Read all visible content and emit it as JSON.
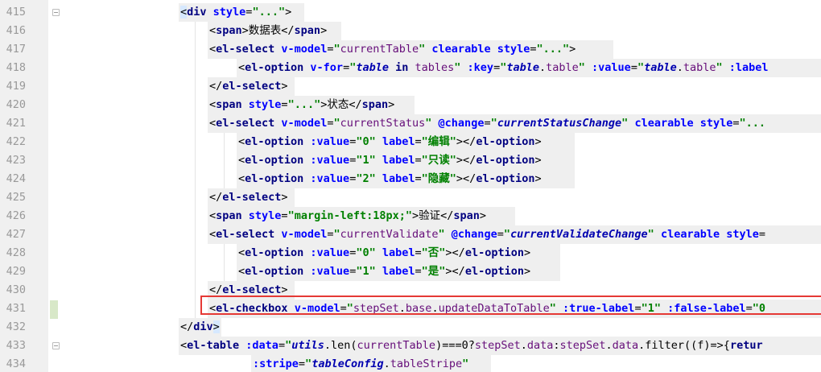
{
  "editor": {
    "lines": [
      {
        "no": "415",
        "segments": [
          {
            "k": "tb",
            "s": "<"
          },
          {
            "k": "t",
            "s": "div "
          },
          {
            "k": "a",
            "s": "style"
          },
          {
            "k": "x",
            "s": "="
          },
          {
            "k": "v",
            "s": "\"...\""
          },
          {
            "k": "x",
            "s": ">"
          }
        ]
      },
      {
        "no": "416",
        "segments": [
          {
            "k": "x",
            "s": "<"
          },
          {
            "k": "t",
            "s": "span"
          },
          {
            "k": "x",
            "s": ">数据表</"
          },
          {
            "k": "t",
            "s": "span"
          },
          {
            "k": "x",
            "s": ">"
          }
        ]
      },
      {
        "no": "417",
        "segments": [
          {
            "k": "x",
            "s": "<"
          },
          {
            "k": "t",
            "s": "el-select "
          },
          {
            "k": "a",
            "s": "v-model"
          },
          {
            "k": "x",
            "s": "="
          },
          {
            "k": "v",
            "s": "\""
          },
          {
            "k": "prop",
            "s": "currentTable"
          },
          {
            "k": "v",
            "s": "\""
          },
          {
            "k": "a",
            "s": " clearable style"
          },
          {
            "k": "x",
            "s": "="
          },
          {
            "k": "v",
            "s": "\"...\""
          },
          {
            "k": "x",
            "s": ">"
          }
        ]
      },
      {
        "no": "418",
        "segments": [
          {
            "k": "x",
            "s": "<"
          },
          {
            "k": "t",
            "s": "el-option "
          },
          {
            "k": "a",
            "s": "v-for"
          },
          {
            "k": "x",
            "s": "="
          },
          {
            "k": "v",
            "s": "\""
          },
          {
            "k": "vb",
            "s": "table"
          },
          {
            "k": "kw",
            "s": " in "
          },
          {
            "k": "prop",
            "s": "tables"
          },
          {
            "k": "v",
            "s": "\""
          },
          {
            "k": "a",
            "s": " :key"
          },
          {
            "k": "x",
            "s": "="
          },
          {
            "k": "v",
            "s": "\""
          },
          {
            "k": "vb",
            "s": "table"
          },
          {
            "k": "x",
            "s": "."
          },
          {
            "k": "prop",
            "s": "table"
          },
          {
            "k": "v",
            "s": "\""
          },
          {
            "k": "a",
            "s": " :value"
          },
          {
            "k": "x",
            "s": "="
          },
          {
            "k": "v",
            "s": "\""
          },
          {
            "k": "vb",
            "s": "table"
          },
          {
            "k": "x",
            "s": "."
          },
          {
            "k": "prop",
            "s": "table"
          },
          {
            "k": "v",
            "s": "\""
          },
          {
            "k": "a",
            "s": " :label"
          }
        ]
      },
      {
        "no": "419",
        "segments": [
          {
            "k": "x",
            "s": "</"
          },
          {
            "k": "t",
            "s": "el-select"
          },
          {
            "k": "x",
            "s": ">"
          }
        ]
      },
      {
        "no": "420",
        "segments": [
          {
            "k": "x",
            "s": "<"
          },
          {
            "k": "t",
            "s": "span "
          },
          {
            "k": "a",
            "s": "style"
          },
          {
            "k": "x",
            "s": "="
          },
          {
            "k": "v",
            "s": "\"...\""
          },
          {
            "k": "x",
            "s": ">状态</"
          },
          {
            "k": "t",
            "s": "span"
          },
          {
            "k": "x",
            "s": ">"
          }
        ]
      },
      {
        "no": "421",
        "segments": [
          {
            "k": "x",
            "s": "<"
          },
          {
            "k": "t",
            "s": "el-select "
          },
          {
            "k": "a",
            "s": "v-model"
          },
          {
            "k": "x",
            "s": "="
          },
          {
            "k": "v",
            "s": "\""
          },
          {
            "k": "prop",
            "s": "currentStatus"
          },
          {
            "k": "v",
            "s": "\""
          },
          {
            "k": "a",
            "s": " @change"
          },
          {
            "k": "x",
            "s": "="
          },
          {
            "k": "v",
            "s": "\""
          },
          {
            "k": "vb",
            "s": "currentStatusChange"
          },
          {
            "k": "v",
            "s": "\""
          },
          {
            "k": "a",
            "s": " clearable style"
          },
          {
            "k": "x",
            "s": "="
          },
          {
            "k": "v",
            "s": "\"..."
          }
        ]
      },
      {
        "no": "422",
        "segments": [
          {
            "k": "x",
            "s": "<"
          },
          {
            "k": "t",
            "s": "el-option "
          },
          {
            "k": "a",
            "s": ":value"
          },
          {
            "k": "x",
            "s": "="
          },
          {
            "k": "v",
            "s": "\"0\""
          },
          {
            "k": "a",
            "s": " label"
          },
          {
            "k": "x",
            "s": "="
          },
          {
            "k": "v",
            "s": "\"编辑\""
          },
          {
            "k": "x",
            "s": "></"
          },
          {
            "k": "t",
            "s": "el-option"
          },
          {
            "k": "x",
            "s": ">"
          }
        ]
      },
      {
        "no": "423",
        "segments": [
          {
            "k": "x",
            "s": "<"
          },
          {
            "k": "t",
            "s": "el-option "
          },
          {
            "k": "a",
            "s": ":value"
          },
          {
            "k": "x",
            "s": "="
          },
          {
            "k": "v",
            "s": "\"1\""
          },
          {
            "k": "a",
            "s": " label"
          },
          {
            "k": "x",
            "s": "="
          },
          {
            "k": "v",
            "s": "\"只读\""
          },
          {
            "k": "x",
            "s": "></"
          },
          {
            "k": "t",
            "s": "el-option"
          },
          {
            "k": "x",
            "s": ">"
          }
        ]
      },
      {
        "no": "424",
        "segments": [
          {
            "k": "x",
            "s": "<"
          },
          {
            "k": "t",
            "s": "el-option "
          },
          {
            "k": "a",
            "s": ":value"
          },
          {
            "k": "x",
            "s": "="
          },
          {
            "k": "v",
            "s": "\"2\""
          },
          {
            "k": "a",
            "s": " label"
          },
          {
            "k": "x",
            "s": "="
          },
          {
            "k": "v",
            "s": "\"隐藏\""
          },
          {
            "k": "x",
            "s": "></"
          },
          {
            "k": "t",
            "s": "el-option"
          },
          {
            "k": "x",
            "s": ">"
          }
        ]
      },
      {
        "no": "425",
        "segments": [
          {
            "k": "x",
            "s": "</"
          },
          {
            "k": "t",
            "s": "el-select"
          },
          {
            "k": "x",
            "s": ">"
          }
        ]
      },
      {
        "no": "426",
        "segments": [
          {
            "k": "x",
            "s": "<"
          },
          {
            "k": "t",
            "s": "span "
          },
          {
            "k": "a",
            "s": "style"
          },
          {
            "k": "x",
            "s": "="
          },
          {
            "k": "v",
            "s": "\"margin-left:18px;\""
          },
          {
            "k": "x",
            "s": ">验证</"
          },
          {
            "k": "t",
            "s": "span"
          },
          {
            "k": "x",
            "s": ">"
          }
        ]
      },
      {
        "no": "427",
        "segments": [
          {
            "k": "x",
            "s": "<"
          },
          {
            "k": "t",
            "s": "el-select "
          },
          {
            "k": "a",
            "s": "v-model"
          },
          {
            "k": "x",
            "s": "="
          },
          {
            "k": "v",
            "s": "\""
          },
          {
            "k": "prop",
            "s": "currentValidate"
          },
          {
            "k": "v",
            "s": "\""
          },
          {
            "k": "a",
            "s": " @change"
          },
          {
            "k": "x",
            "s": "="
          },
          {
            "k": "v",
            "s": "\""
          },
          {
            "k": "vb",
            "s": "currentValidateChange"
          },
          {
            "k": "v",
            "s": "\""
          },
          {
            "k": "a",
            "s": " clearable style"
          },
          {
            "k": "x",
            "s": "="
          }
        ]
      },
      {
        "no": "428",
        "segments": [
          {
            "k": "x",
            "s": "<"
          },
          {
            "k": "t",
            "s": "el-option "
          },
          {
            "k": "a",
            "s": ":value"
          },
          {
            "k": "x",
            "s": "="
          },
          {
            "k": "v",
            "s": "\"0\""
          },
          {
            "k": "a",
            "s": " label"
          },
          {
            "k": "x",
            "s": "="
          },
          {
            "k": "v",
            "s": "\"否\""
          },
          {
            "k": "x",
            "s": "></"
          },
          {
            "k": "t",
            "s": "el-option"
          },
          {
            "k": "x",
            "s": ">"
          }
        ]
      },
      {
        "no": "429",
        "segments": [
          {
            "k": "x",
            "s": "<"
          },
          {
            "k": "t",
            "s": "el-option "
          },
          {
            "k": "a",
            "s": ":value"
          },
          {
            "k": "x",
            "s": "="
          },
          {
            "k": "v",
            "s": "\"1\""
          },
          {
            "k": "a",
            "s": " label"
          },
          {
            "k": "x",
            "s": "="
          },
          {
            "k": "v",
            "s": "\"是\""
          },
          {
            "k": "x",
            "s": "></"
          },
          {
            "k": "t",
            "s": "el-option"
          },
          {
            "k": "x",
            "s": ">"
          }
        ]
      },
      {
        "no": "430",
        "segments": [
          {
            "k": "x",
            "s": "</"
          },
          {
            "k": "t",
            "s": "el-select"
          },
          {
            "k": "x",
            "s": ">"
          }
        ]
      },
      {
        "no": "431",
        "segments": [
          {
            "k": "x",
            "s": "<"
          },
          {
            "k": "t",
            "s": "el-checkbox "
          },
          {
            "k": "a",
            "s": "v-model"
          },
          {
            "k": "x",
            "s": "="
          },
          {
            "k": "v",
            "s": "\""
          },
          {
            "k": "prop",
            "s": "stepSet"
          },
          {
            "k": "x",
            "s": "."
          },
          {
            "k": "prop",
            "s": "base"
          },
          {
            "k": "x",
            "s": "."
          },
          {
            "k": "prop",
            "s": "updateDataToTable"
          },
          {
            "k": "v",
            "s": "\""
          },
          {
            "k": "a",
            "s": " :true-label"
          },
          {
            "k": "x",
            "s": "="
          },
          {
            "k": "v",
            "s": "\"1\""
          },
          {
            "k": "a",
            "s": " :false-label"
          },
          {
            "k": "x",
            "s": "="
          },
          {
            "k": "v",
            "s": "\"0"
          }
        ]
      },
      {
        "no": "432",
        "segments": [
          {
            "k": "x",
            "s": "</"
          },
          {
            "k": "t",
            "s": "div"
          },
          {
            "k": "tb",
            "s": ">"
          }
        ]
      },
      {
        "no": "433",
        "segments": [
          {
            "k": "x",
            "s": "<"
          },
          {
            "k": "t",
            "s": "el-table "
          },
          {
            "k": "a",
            "s": ":data"
          },
          {
            "k": "x",
            "s": "="
          },
          {
            "k": "v",
            "s": "\""
          },
          {
            "k": "vb",
            "s": "utils"
          },
          {
            "k": "x",
            "s": "."
          },
          {
            "k": "x",
            "s": "len("
          },
          {
            "k": "prop",
            "s": "currentTable"
          },
          {
            "k": "x",
            "s": ")===0?"
          },
          {
            "k": "prop",
            "s": "stepSet"
          },
          {
            "k": "x",
            "s": "."
          },
          {
            "k": "prop",
            "s": "data"
          },
          {
            "k": "x",
            "s": ":"
          },
          {
            "k": "prop",
            "s": "stepSet"
          },
          {
            "k": "x",
            "s": "."
          },
          {
            "k": "prop",
            "s": "data"
          },
          {
            "k": "x",
            "s": "."
          },
          {
            "k": "x",
            "s": "filter(("
          },
          {
            "k": "x",
            "s": "f"
          },
          {
            "k": "x",
            "s": ")=>{"
          },
          {
            "k": "kw",
            "s": "retur"
          }
        ]
      },
      {
        "no": "434",
        "segments": [
          {
            "k": "a",
            "s": ":stripe"
          },
          {
            "k": "x",
            "s": "="
          },
          {
            "k": "v",
            "s": "\""
          },
          {
            "k": "vb",
            "s": "tableConfig"
          },
          {
            "k": "x",
            "s": "."
          },
          {
            "k": "prop",
            "s": "tableStripe"
          },
          {
            "k": "v",
            "s": "\""
          }
        ]
      }
    ]
  }
}
